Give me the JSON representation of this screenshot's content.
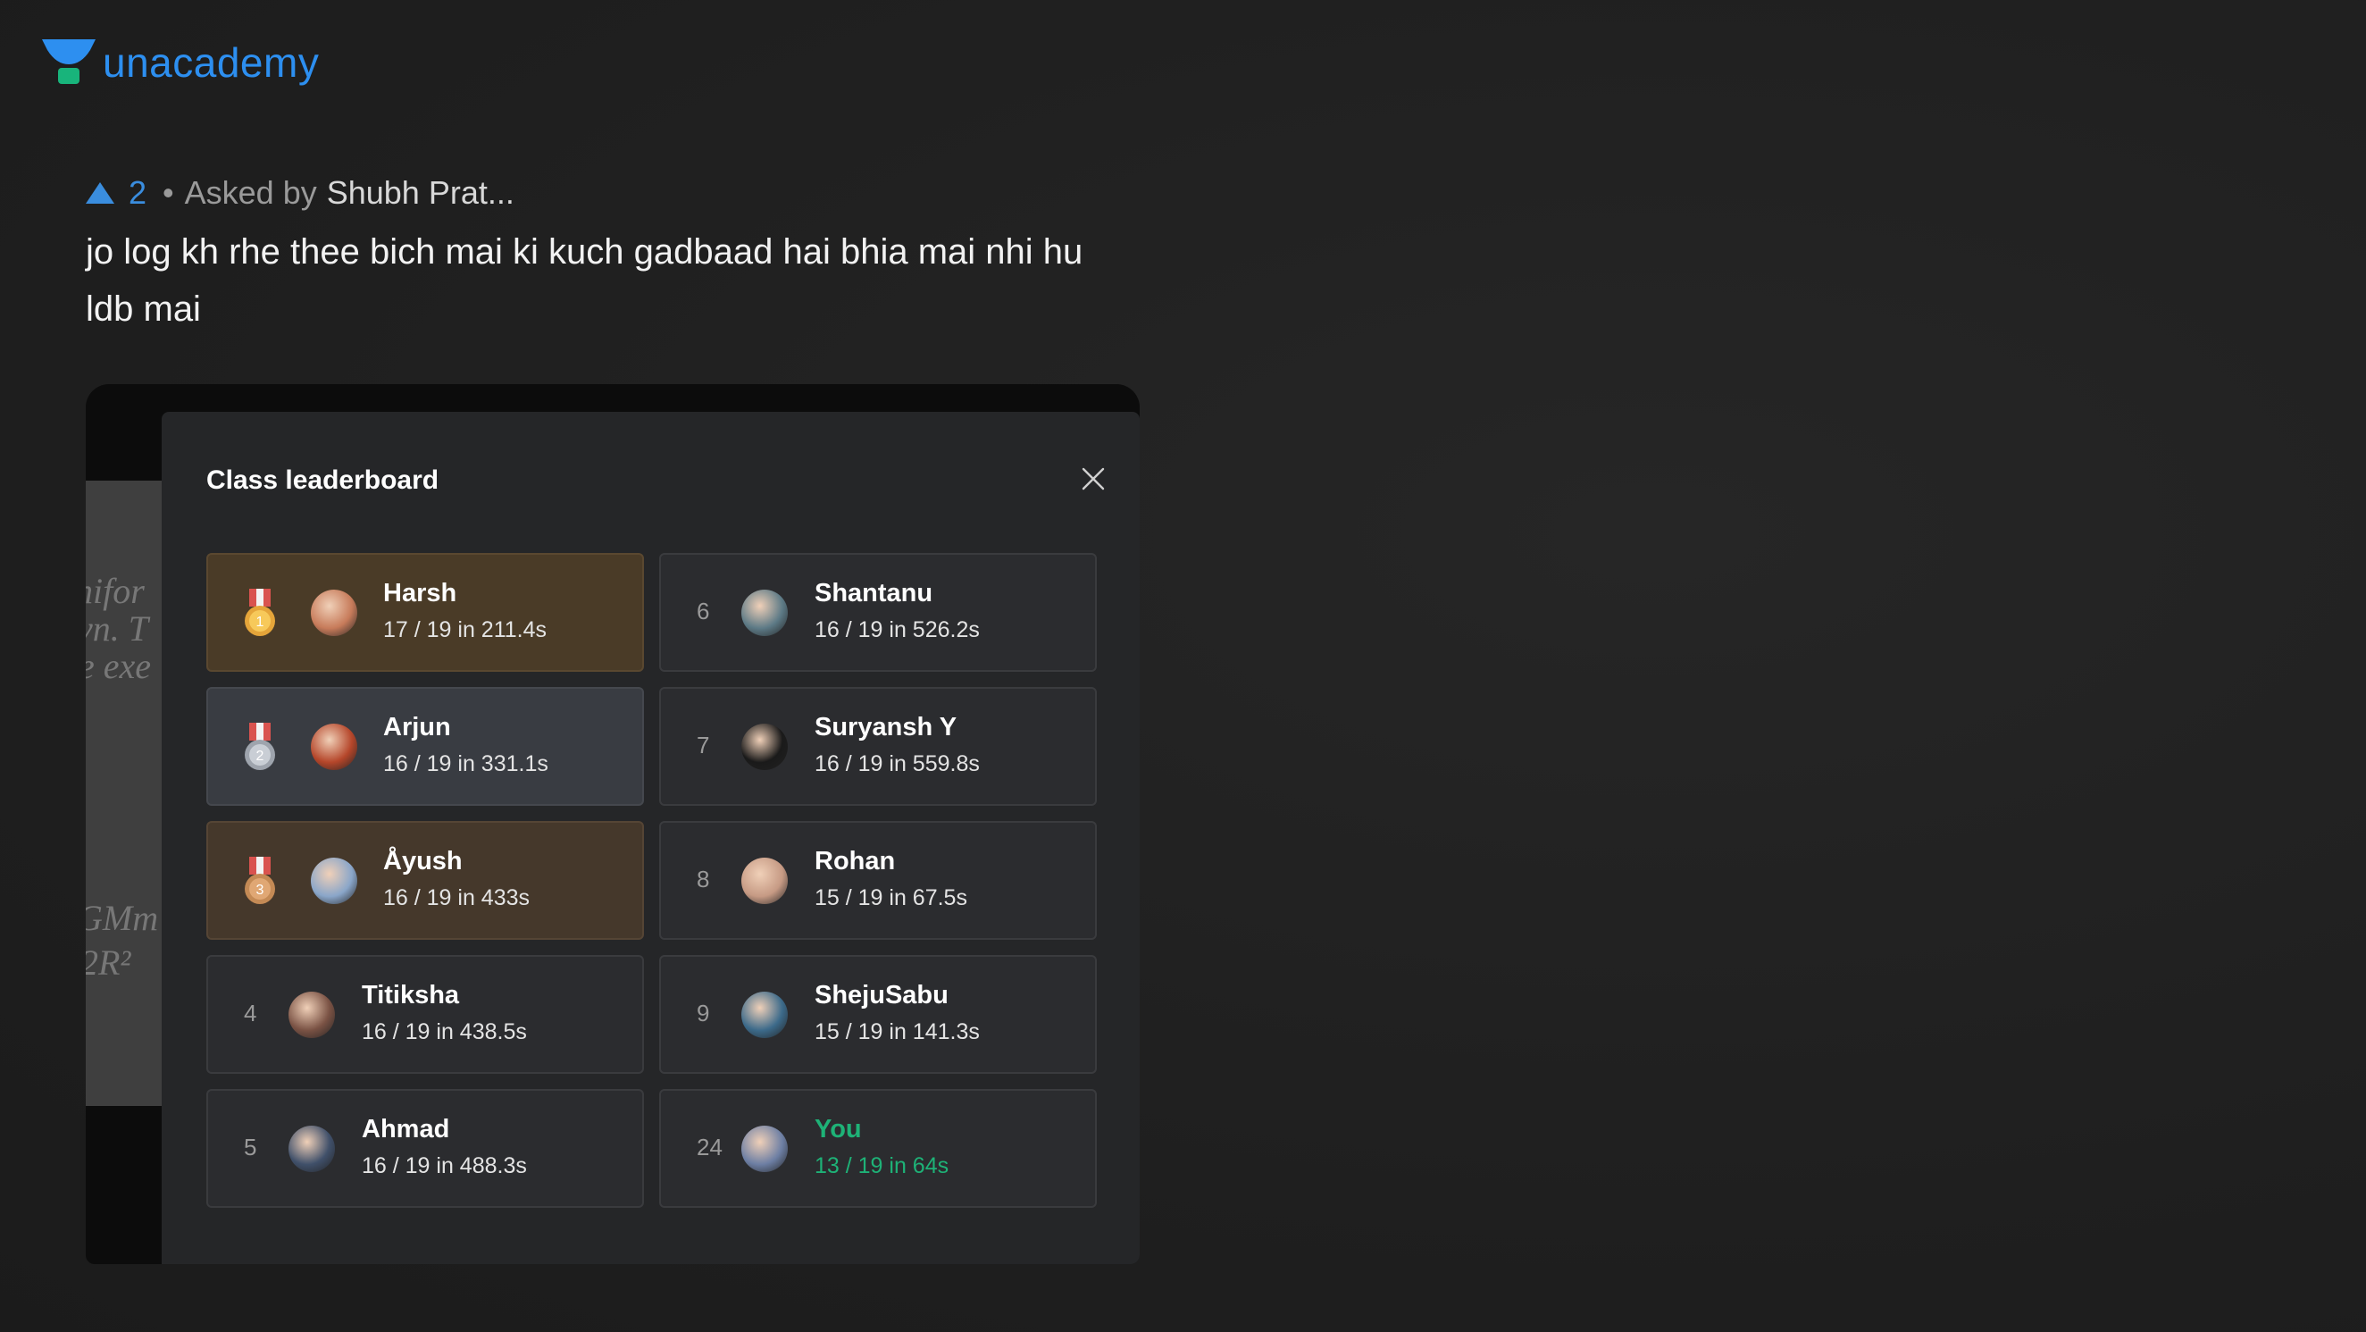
{
  "brand": {
    "name": "unacademy",
    "color": "#2d8ff0"
  },
  "question": {
    "upvote_icon": "upvote-triangle-icon",
    "votes": "2",
    "separator": "•",
    "asked_by_label": "Asked by",
    "asker": "Shubh Prat...",
    "text": "jo log kh rhe thee bich mai ki kuch gadbaad hai bhia mai nhi hu ldb mai"
  },
  "attachment": {
    "background_text": [
      "nifor",
      "vn. T",
      "e exe",
      "GMm",
      "2R²"
    ],
    "leaderboard": {
      "title": "Class leaderboard",
      "close_icon": "close-icon",
      "entries": [
        {
          "rank": "1",
          "name": "Harsh",
          "score": "17 / 19 in 211.4s",
          "medal": "gold",
          "avatar_color": "#c77b5a"
        },
        {
          "rank": "6",
          "name": "Shantanu",
          "score": "16 / 19 in 526.2s",
          "avatar_color": "#5d7a86"
        },
        {
          "rank": "2",
          "name": "Arjun",
          "score": "16 / 19 in 331.1s",
          "medal": "silver",
          "avatar_color": "#b5462a"
        },
        {
          "rank": "7",
          "name": "Suryansh Y",
          "score": "16 / 19 in 559.8s",
          "avatar_color": "#1a1a1a"
        },
        {
          "rank": "3",
          "name": "Åyush",
          "score": "16 / 19 in 433s",
          "medal": "bronze",
          "avatar_color": "#8aa6c9"
        },
        {
          "rank": "8",
          "name": "Rohan",
          "score": "15 / 19 in 67.5s",
          "avatar_color": "#c69a84"
        },
        {
          "rank": "4",
          "name": "Titiksha",
          "score": "16 / 19 in 438.5s",
          "avatar_color": "#7a5244"
        },
        {
          "rank": "9",
          "name": "ShejuSabu",
          "score": "15 / 19 in 141.3s",
          "avatar_color": "#3c6a8a"
        },
        {
          "rank": "5",
          "name": "Ahmad",
          "score": "16 / 19 in 488.3s",
          "avatar_color": "#40506a"
        },
        {
          "rank": "24",
          "name": "You",
          "score": "13 / 19 in 64s",
          "you": true,
          "avatar_color": "#6d7fa4"
        }
      ]
    }
  },
  "colors": {
    "gold_card": "#4a3b27",
    "silver_card": "#393c42",
    "bronze_card": "#45382b",
    "you_text": "#1eb277",
    "vote_blue": "#3a8dde"
  }
}
